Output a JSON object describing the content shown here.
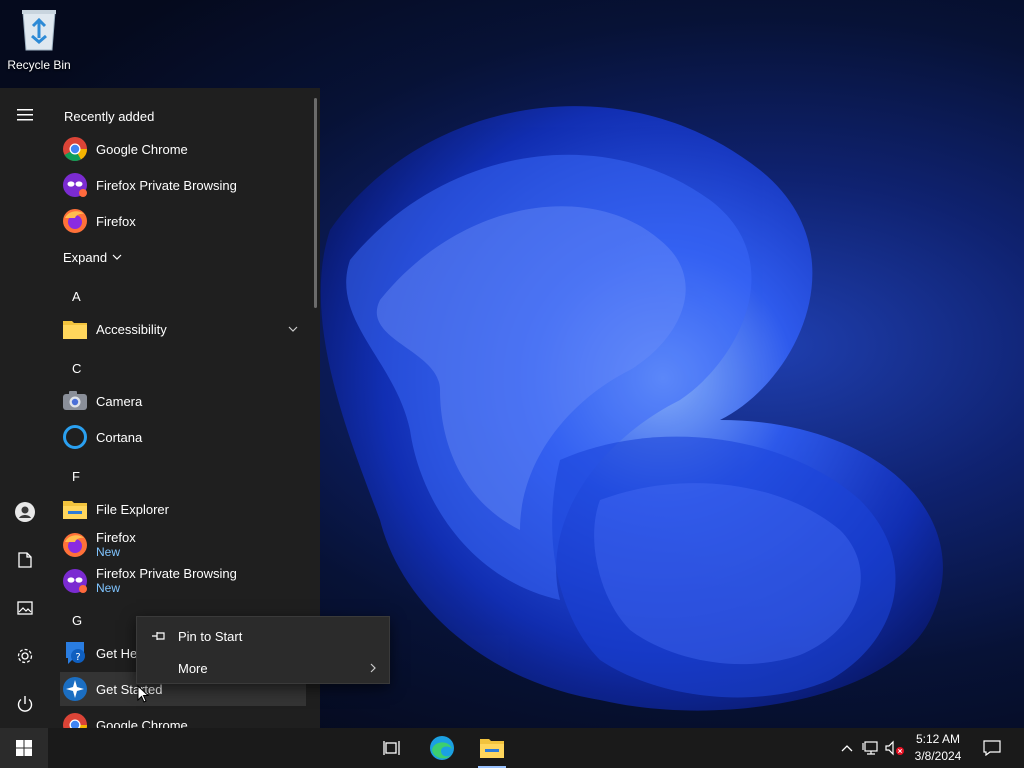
{
  "desktop": {
    "recycle_bin_label": "Recycle Bin"
  },
  "start_menu": {
    "recently_added_title": "Recently added",
    "recent": [
      {
        "name": "Google Chrome",
        "icon": "chrome-icon"
      },
      {
        "name": "Firefox Private Browsing",
        "icon": "firefox-private-icon"
      },
      {
        "name": "Firefox",
        "icon": "firefox-icon"
      }
    ],
    "expand_label": "Expand",
    "letters": {
      "a": "A",
      "c": "C",
      "f": "F",
      "g": "G"
    },
    "apps": {
      "accessibility": "Accessibility",
      "camera": "Camera",
      "cortana": "Cortana",
      "file_explorer": "File Explorer",
      "firefox": "Firefox",
      "firefox_new": "New",
      "firefox_private": "Firefox Private Browsing",
      "firefox_private_new": "New",
      "get_help": "Get Help",
      "get_started": "Get Started",
      "google_chrome": "Google Chrome"
    },
    "rail_icons": [
      "hamburger-icon",
      "user-icon",
      "documents-icon",
      "pictures-icon",
      "settings-icon",
      "power-icon"
    ]
  },
  "context_menu": {
    "pin_to_start": "Pin to Start",
    "more": "More"
  },
  "taskbar": {
    "time": "5:12 AM",
    "date": "3/8/2024",
    "icons": [
      "start-icon",
      "task-view-icon",
      "edge-icon",
      "file-explorer-icon",
      "chevron-up-icon",
      "network-icon",
      "volume-muted-icon",
      "notification-icon"
    ]
  },
  "colors": {
    "accent_new": "#7fc4ff",
    "menu_bg": "#1f1f1f",
    "taskbar_bg": "#1a1a1a"
  }
}
